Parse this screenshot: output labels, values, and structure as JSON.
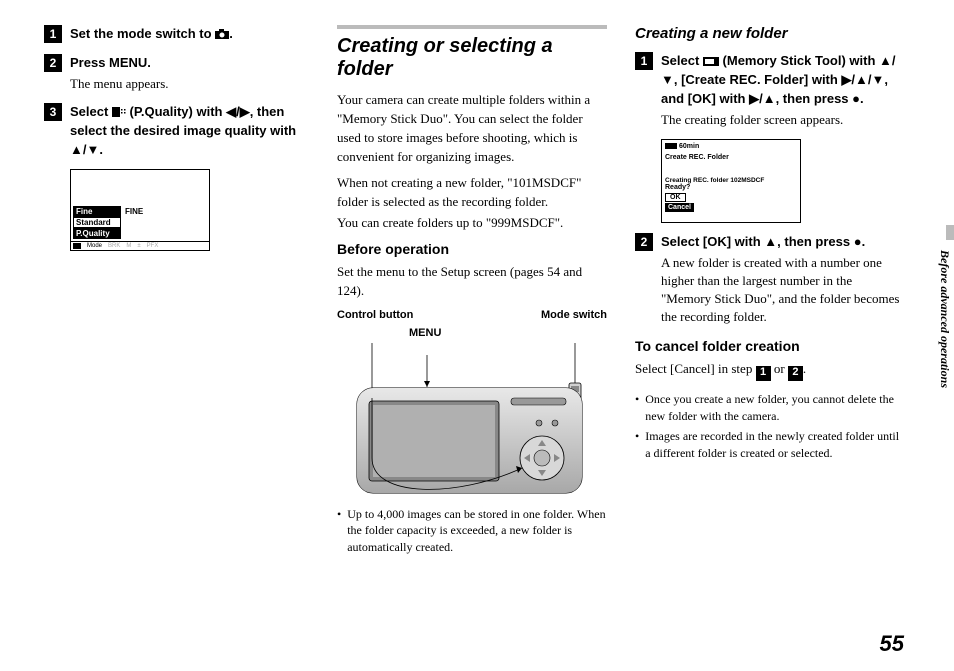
{
  "col1": {
    "step1": {
      "title_a": "Set the mode switch to ",
      "title_b": "."
    },
    "step2": {
      "title": "Press MENU.",
      "sub": "The menu appears."
    },
    "step3": {
      "title": "Select  (P.Quality) with ◀/▶, then select the desired image quality with ▲/▼."
    },
    "lcd": {
      "fine": "Fine",
      "fine_right": "FINE",
      "standard": "Standard",
      "pquality": "P.Quality",
      "bottom": {
        "mode": "Mode",
        "brk": "BRK",
        "m": "M",
        "pfx": "PFX"
      }
    }
  },
  "col2": {
    "title": "Creating or selecting a folder",
    "p1": "Your camera can create multiple folders within a \"Memory Stick Duo\". You can select the folder used to store images before shooting, which is convenient for organizing images.",
    "p2": "When not creating a new folder, \"101MSDCF\" folder is selected as the recording folder.",
    "p3": "You can create folders up to \"999MSDCF\".",
    "before_op": "Before operation",
    "before_op_body": "Set the menu to the Setup screen (pages 54 and 124).",
    "labels": {
      "control": "Control button",
      "menu": "MENU",
      "mode": "Mode switch"
    },
    "note1": "Up to 4,000 images can be stored in one folder. When the folder capacity is exceeded, a new folder is automatically created."
  },
  "col3": {
    "title": "Creating a new folder",
    "step1": {
      "title": "Select  (Memory Stick Tool) with ▲/▼, [Create REC. Folder] with ▶/▲/▼, and [OK] with ▶/▲, then press ●.",
      "sub": "The creating folder screen appears."
    },
    "lcd": {
      "min": "60min",
      "title": "Create REC. Folder",
      "msg": "Creating REC. folder  102MSDCF",
      "ready": "Ready?",
      "ok": "OK",
      "cancel": "Cancel"
    },
    "step2": {
      "title": "Select [OK] with ▲, then press ●.",
      "sub": "A new folder is created with a number one higher than the largest number in the \"Memory Stick Duo\", and the folder becomes the recording folder."
    },
    "cancel_head": "To cancel folder creation",
    "cancel_body_a": "Select [Cancel] in step ",
    "cancel_body_b": " or ",
    "cancel_body_c": ".",
    "bullet1": "Once you create a new folder, you cannot delete the new folder with the camera.",
    "bullet2": "Images are recorded in the newly created folder until a different folder is created or selected."
  },
  "side": "Before advanced operations",
  "page": "55"
}
